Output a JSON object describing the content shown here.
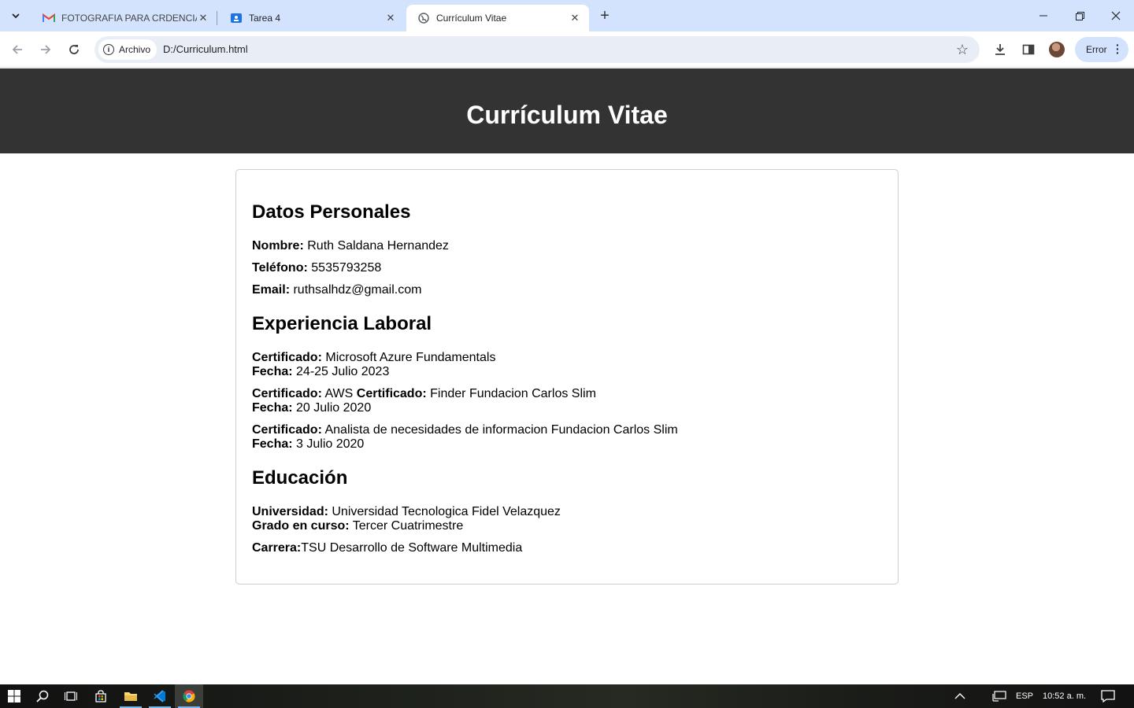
{
  "browser": {
    "tabs": [
      {
        "title": "FOTOGRAFIA PARA CRDENCIAL",
        "favicon": "gmail-icon",
        "active": false
      },
      {
        "title": "Tarea 4",
        "favicon": "classroom-icon",
        "active": false
      },
      {
        "title": "Currículum Vitae",
        "favicon": "globe-icon",
        "active": true
      }
    ],
    "site_chip": "Archivo",
    "url": "D:/Curriculum.html",
    "profile_button": "Error"
  },
  "page": {
    "header_title": "Currículum Vitae",
    "personal": {
      "heading": "Datos Personales",
      "name_label": "Nombre:",
      "name_value": "Ruth Saldana Hernandez",
      "phone_label": "Teléfono:",
      "phone_value": "5535793258",
      "email_label": "Email:",
      "email_value": "ruthsalhdz@gmail.com"
    },
    "experience": {
      "heading": "Experiencia Laboral",
      "items": [
        {
          "cert_label": "Certificado:",
          "cert_value": "Microsoft Azure Fundamentals",
          "date_label": "Fecha:",
          "date_value": "24-25 Julio 2023"
        },
        {
          "cert_label": "Certificado:",
          "cert_value": "AWS",
          "cert2_label": "Certificado:",
          "cert2_value": "Finder Fundacion Carlos Slim",
          "date_label": "Fecha:",
          "date_value": "20 Julio 2020"
        },
        {
          "cert_label": "Certificado:",
          "cert_value": "Analista de necesidades de informacion Fundacion Carlos Slim",
          "date_label": "Fecha:",
          "date_value": "3 Julio 2020"
        }
      ]
    },
    "education": {
      "heading": "Educación",
      "university_label": "Universidad:",
      "university_value": "Universidad Tecnologica Fidel Velazquez",
      "grade_label": "Grado en curso:",
      "grade_value": "Tercer Cuatrimestre",
      "career_label": "Carrera:",
      "career_value": "TSU Desarrollo de Software Multimedia"
    }
  },
  "taskbar": {
    "language": "ESP",
    "clock": "10:52 a. m."
  }
}
